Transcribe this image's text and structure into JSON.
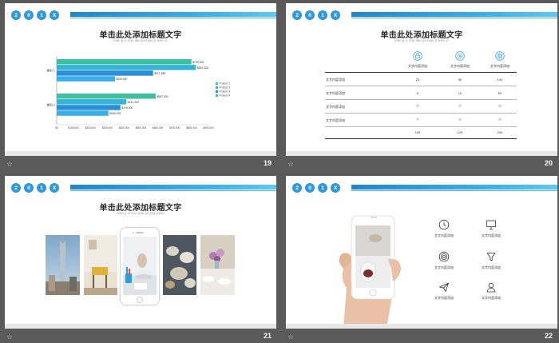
{
  "header_dots": [
    "2",
    "0",
    "1",
    "X"
  ],
  "slide19": {
    "number": "19",
    "title": "单击此处添加标题文字",
    "subtitle": "Dan ji ci chu tian jia biao ti wen zi",
    "footer_icon": "star-outline-icon"
  },
  "chart_data": {
    "type": "bar",
    "orientation": "horizontal",
    "categories": [
      "类别 1",
      "类别 2"
    ],
    "series": [
      {
        "name": "Product 1",
        "color": "#3dbfa0",
        "values": [
          799000,
          587000
        ]
      },
      {
        "name": "Product 2",
        "color": "#35b4d6",
        "values": [
          825426,
          413200
        ]
      },
      {
        "name": "Product 3",
        "color": "#2a8fd6",
        "values": [
          571850,
          378000
        ]
      },
      {
        "name": "Product 4",
        "color": "#3aaee8",
        "values": [
          345987,
          306376
        ]
      }
    ],
    "value_labels": [
      [
        "$799,000",
        "$825,426",
        "$571,850",
        "$345,987"
      ],
      [
        "$587,000",
        "$413,200",
        "$378,000",
        "$306,376"
      ]
    ],
    "xticks": [
      "$0",
      "$100,000",
      "$200,000",
      "$300,000",
      "$400,000",
      "$500,000",
      "$600,000",
      "$700,000",
      "$800,000",
      "$900,000"
    ],
    "xlim": [
      0,
      900000
    ],
    "legend_position": "right"
  },
  "slide20": {
    "number": "20",
    "title": "单击此处添加标题文字",
    "subtitle": "Dan ji ci chu tian jia biao ti wen zi",
    "columns": [
      {
        "icon": "lock-icon",
        "label": "文字内容添加"
      },
      {
        "icon": "gear-icon",
        "label": "文字内容添加"
      },
      {
        "icon": "target-icon",
        "label": "文字内容添加"
      }
    ],
    "rows": [
      {
        "label": "文字内容添加",
        "cells": [
          "25",
          "50",
          "100"
        ],
        "type": "text"
      },
      {
        "label": "文字内容添加",
        "cells": [
          "5",
          "10",
          "50"
        ],
        "type": "text"
      },
      {
        "label": "文字内容添加",
        "cells": [
          "check",
          "check",
          "check"
        ],
        "type": "mark"
      },
      {
        "label": "文字内容添加",
        "cells": [
          "cross",
          "check",
          "check"
        ],
        "type": "mark"
      }
    ],
    "totals": [
      "105",
      "125",
      "205"
    ]
  },
  "slide21": {
    "number": "21",
    "title": "单击此处添加标题文字",
    "subtitle": "Dan ji ci chu tian jia ying wen",
    "photos": [
      "skyscraper-photo",
      "chair-room-photo",
      "phone-desk-photo",
      "table-dishes-photo",
      "flowers-table-photo"
    ]
  },
  "slide22": {
    "number": "22",
    "features": [
      {
        "icon": "clock-icon",
        "label": "文字内容添加"
      },
      {
        "icon": "monitor-icon",
        "label": "文字内容添加"
      },
      {
        "icon": "target-icon",
        "label": "文字内容添加"
      },
      {
        "icon": "filter-icon",
        "label": "文字内容添加"
      },
      {
        "icon": "paper-plane-icon",
        "label": "文字内容添加"
      },
      {
        "icon": "users-icon",
        "label": "文字内容添加"
      }
    ]
  },
  "footer_star": "☆"
}
